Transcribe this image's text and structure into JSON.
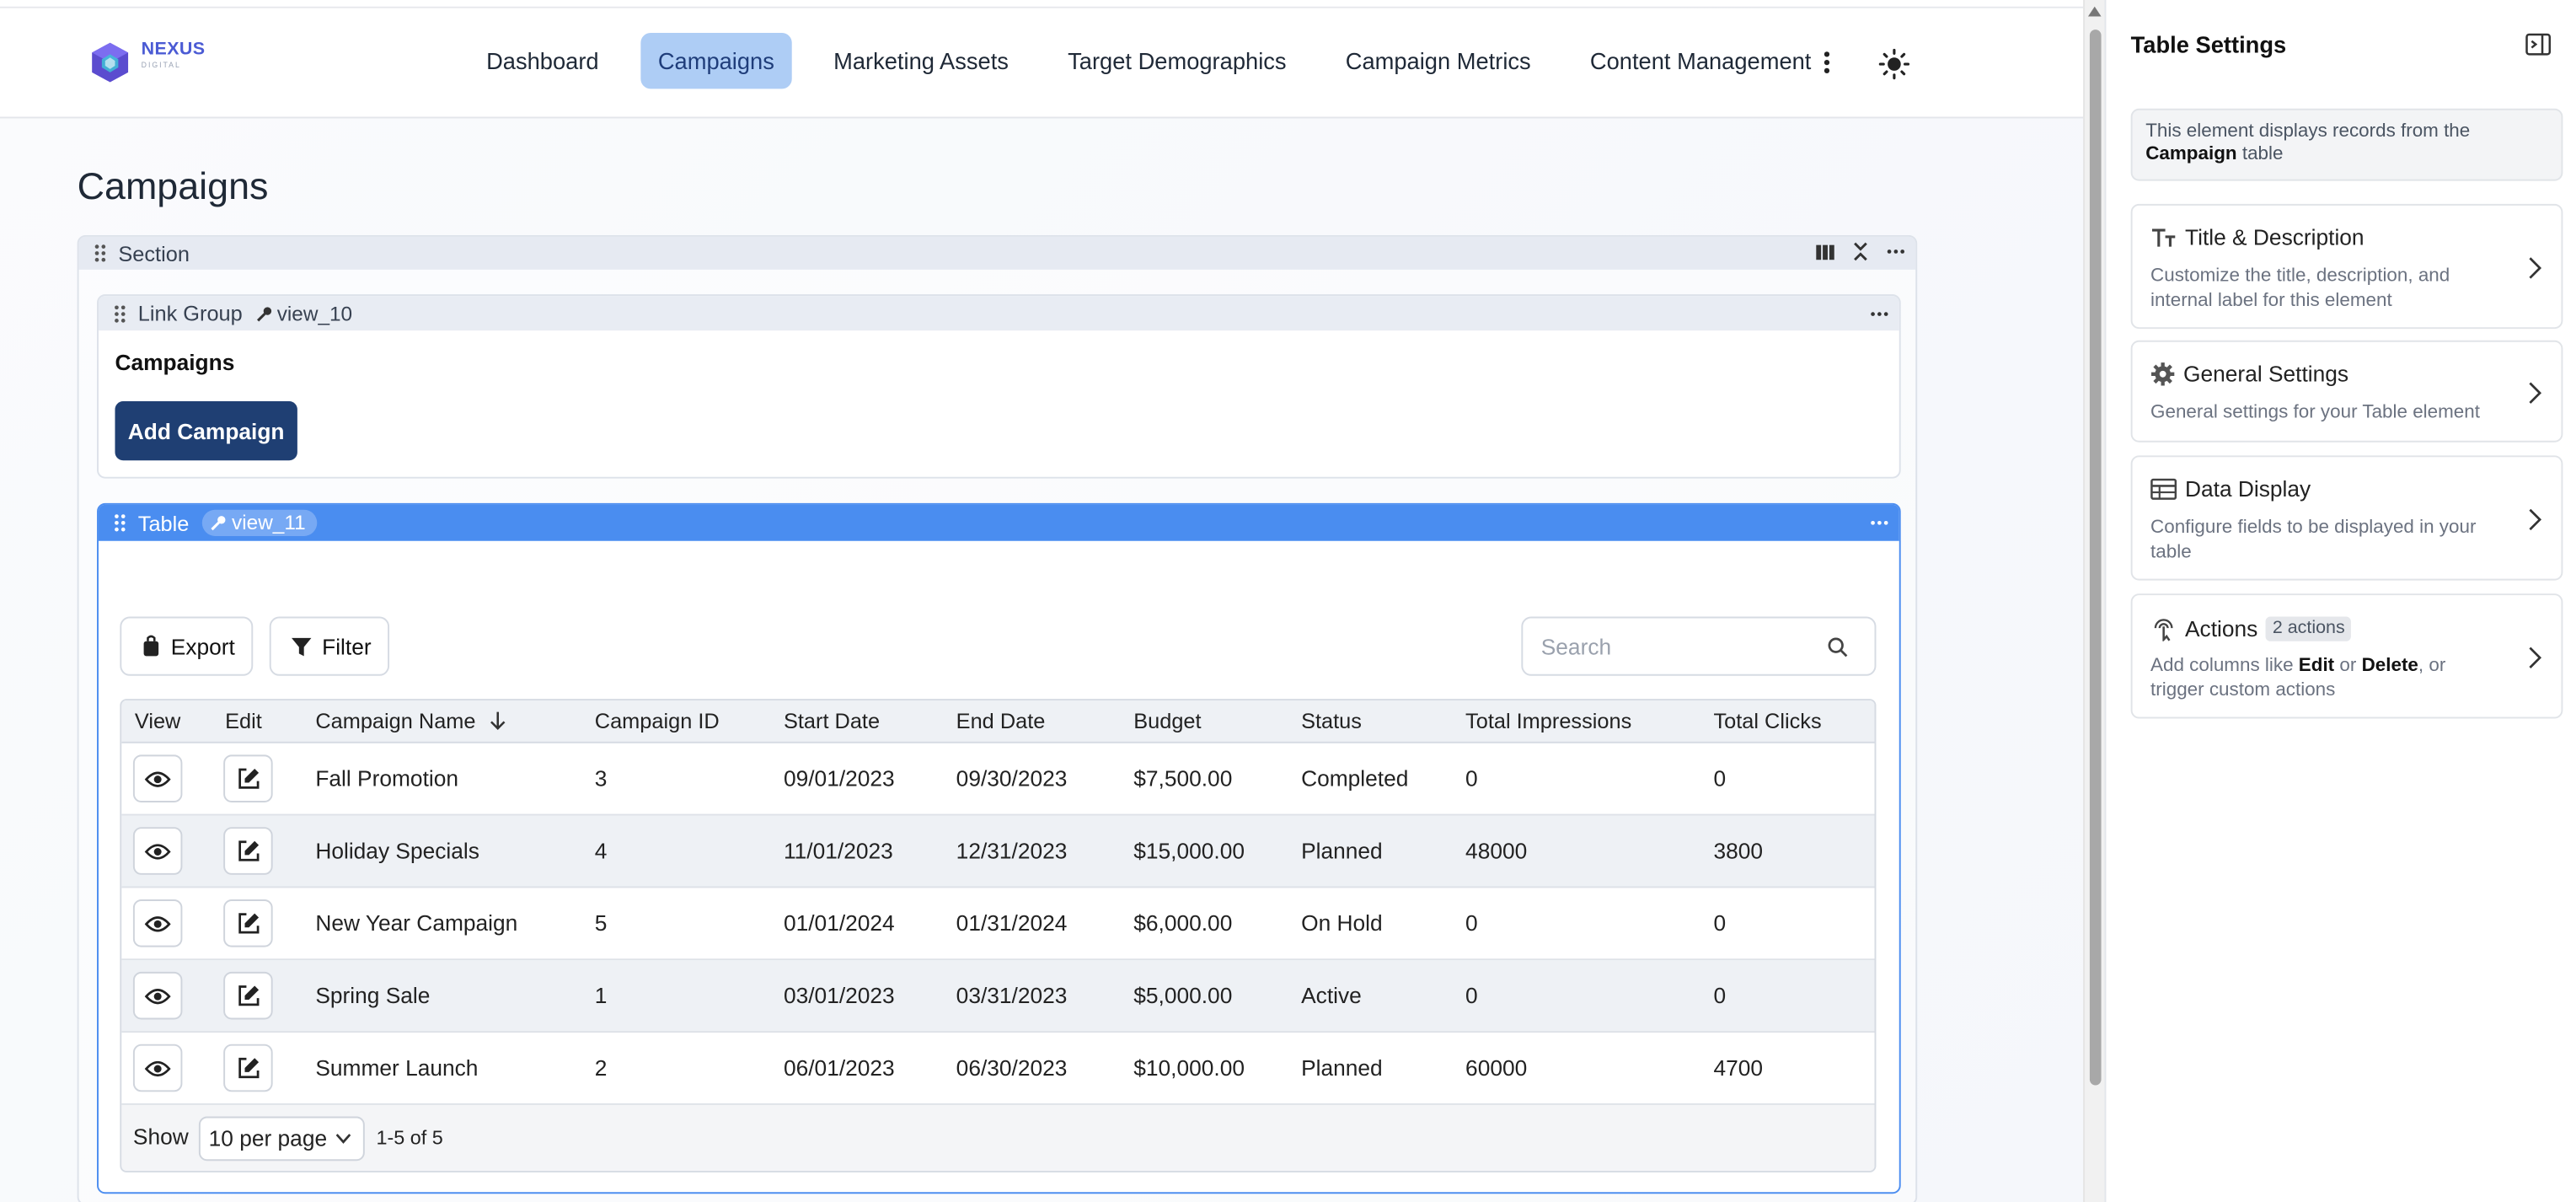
{
  "logo": {
    "name": "NEXUS",
    "sub": "DIGITAL"
  },
  "nav": {
    "items": [
      {
        "label": "Dashboard",
        "active": false
      },
      {
        "label": "Campaigns",
        "active": true
      },
      {
        "label": "Marketing Assets",
        "active": false
      },
      {
        "label": "Target Demographics",
        "active": false
      },
      {
        "label": "Campaign Metrics",
        "active": false
      },
      {
        "label": "Content Management",
        "active": false
      }
    ],
    "more_icon": "more-vertical-icon",
    "theme_icon": "sun-icon"
  },
  "page": {
    "title": "Campaigns"
  },
  "section": {
    "label": "Section"
  },
  "link_group": {
    "label": "Link Group",
    "view_key": "view_10",
    "heading": "Campaigns",
    "add_button": "Add Campaign"
  },
  "table_element": {
    "label": "Table",
    "view_key": "view_11",
    "export_label": "Export",
    "filter_label": "Filter",
    "search_placeholder": "Search",
    "columns": [
      "View",
      "Edit",
      "Campaign Name",
      "Campaign ID",
      "Start Date",
      "End Date",
      "Budget",
      "Status",
      "Total Impressions",
      "Total Clicks"
    ],
    "rows": [
      {
        "name": "Fall Promotion",
        "id": "3",
        "start": "09/01/2023",
        "end": "09/30/2023",
        "budget": "$7,500.00",
        "status": "Completed",
        "impressions": "0",
        "clicks": "0"
      },
      {
        "name": "Holiday Specials",
        "id": "4",
        "start": "11/01/2023",
        "end": "12/31/2023",
        "budget": "$15,000.00",
        "status": "Planned",
        "impressions": "48000",
        "clicks": "3800"
      },
      {
        "name": "New Year Campaign",
        "id": "5",
        "start": "01/01/2024",
        "end": "01/31/2024",
        "budget": "$6,000.00",
        "status": "On Hold",
        "impressions": "0",
        "clicks": "0"
      },
      {
        "name": "Spring Sale",
        "id": "1",
        "start": "03/01/2023",
        "end": "03/31/2023",
        "budget": "$5,000.00",
        "status": "Active",
        "impressions": "0",
        "clicks": "0"
      },
      {
        "name": "Summer Launch",
        "id": "2",
        "start": "06/01/2023",
        "end": "06/30/2023",
        "budget": "$10,000.00",
        "status": "Planned",
        "impressions": "60000",
        "clicks": "4700"
      }
    ],
    "pager": {
      "show_label": "Show",
      "per_page": "10 per page",
      "range": "1-5 of 5"
    }
  },
  "panel": {
    "title": "Table Settings",
    "info_prefix": "This element displays records from the",
    "info_table": "Campaign",
    "info_suffix": "table",
    "cards": {
      "title_desc": {
        "title": "Title & Description",
        "desc": "Customize the title, description, and internal label for this element"
      },
      "general": {
        "title": "General Settings",
        "desc": "General settings for your Table element"
      },
      "data_display": {
        "title": "Data Display",
        "desc": "Configure fields to be displayed in your table"
      },
      "actions": {
        "title": "Actions",
        "badge": "2 actions",
        "desc_1": "Add columns like",
        "desc_edit": "Edit",
        "desc_or": "or",
        "desc_delete": "Delete",
        "desc_2": ", or trigger custom actions"
      }
    }
  },
  "colors": {
    "accent": "#4a8df0",
    "primary_button": "#1f3f73",
    "nav_active": "#aecdf5"
  }
}
